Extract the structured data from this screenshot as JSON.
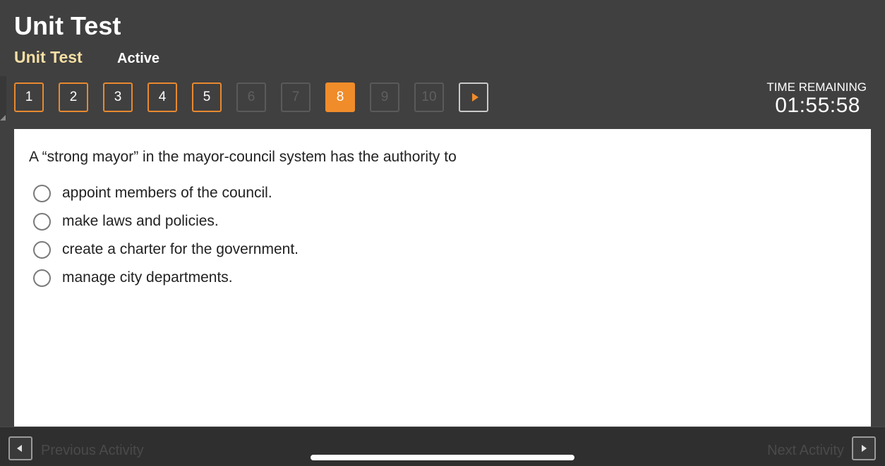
{
  "header": {
    "title": "Unit Test",
    "subtitle": "Unit Test",
    "status": "Active"
  },
  "question_nav": {
    "items": [
      {
        "label": "1",
        "state": "available"
      },
      {
        "label": "2",
        "state": "available"
      },
      {
        "label": "3",
        "state": "available"
      },
      {
        "label": "4",
        "state": "available"
      },
      {
        "label": "5",
        "state": "available"
      },
      {
        "label": "6",
        "state": "disabled"
      },
      {
        "label": "7",
        "state": "disabled"
      },
      {
        "label": "8",
        "state": "current"
      },
      {
        "label": "9",
        "state": "disabled"
      },
      {
        "label": "10",
        "state": "disabled"
      }
    ],
    "next_icon": "play-arrow-icon",
    "accent_color": "#f18c2a"
  },
  "timer": {
    "label": "TIME REMAINING",
    "value": "01:55:58"
  },
  "question": {
    "text": "A “strong mayor” in the mayor-council system has the authority to",
    "options": [
      "appoint members of the council.",
      "make laws and policies.",
      "create a charter for the government.",
      "manage city departments."
    ]
  },
  "footer": {
    "previous_label": "Previous Activity",
    "next_label": "Next Activity",
    "previous_icon": "chevron-left-icon",
    "next_icon": "chevron-right-icon"
  }
}
